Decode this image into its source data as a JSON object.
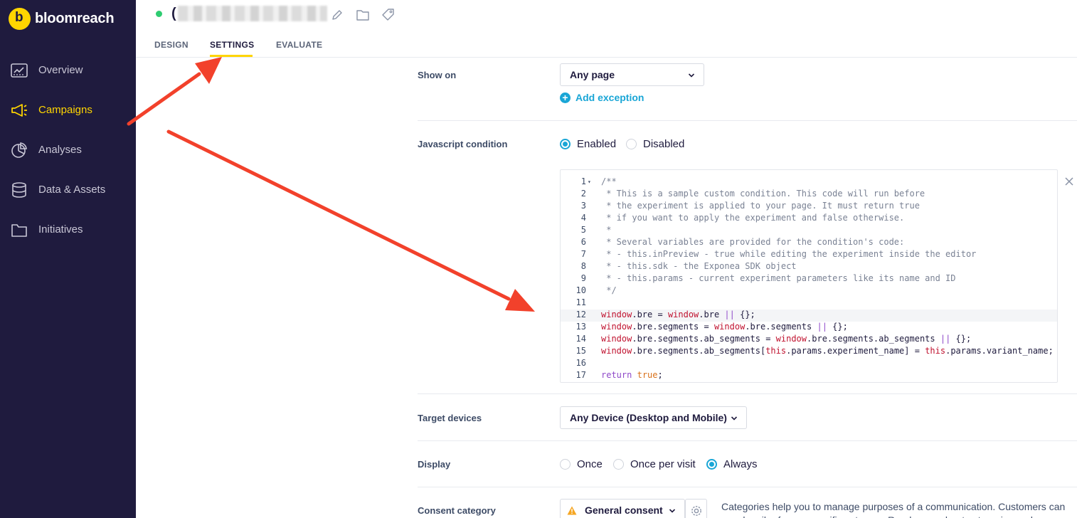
{
  "brand": {
    "name": "bloomreach",
    "mark": "b"
  },
  "sidebar": {
    "items": [
      {
        "label": "Overview",
        "icon": "overview-icon"
      },
      {
        "label": "Campaigns",
        "icon": "megaphone-icon",
        "active": true
      },
      {
        "label": "Analyses",
        "icon": "pie-chart-icon"
      },
      {
        "label": "Data & Assets",
        "icon": "database-icon"
      },
      {
        "label": "Initiatives",
        "icon": "folder-icon"
      }
    ]
  },
  "header": {
    "title_prefix": "(",
    "tabs": [
      "DESIGN",
      "SETTINGS",
      "EVALUATE"
    ],
    "active_tab": "SETTINGS"
  },
  "settings": {
    "show_on": {
      "label": "Show on",
      "value": "Any page",
      "add_exception": "Add exception"
    },
    "js_condition": {
      "label": "Javascript condition",
      "options": [
        "Enabled",
        "Disabled"
      ],
      "selected": "Enabled",
      "code": [
        "/**",
        " * This is a sample custom condition. This code will run before",
        " * the experiment is applied to your page. It must return true",
        " * if you want to apply the experiment and false otherwise.",
        " *",
        " * Several variables are provided for the condition's code:",
        " * - this.inPreview - true while editing the experiment inside the editor",
        " * - this.sdk - the Exponea SDK object",
        " * - this.params - current experiment parameters like its name and ID",
        " */",
        "",
        "window.bre = window.bre || {};",
        "window.bre.segments = window.bre.segments || {};",
        "window.bre.segments.ab_segments = window.bre.segments.ab_segments || {};",
        "window.bre.segments.ab_segments[this.params.experiment_name] = this.params.variant_name;",
        "",
        "return true;"
      ]
    },
    "target_devices": {
      "label": "Target devices",
      "value": "Any Device (Desktop and Mobile)"
    },
    "display": {
      "label": "Display",
      "options": [
        "Once",
        "Once per visit",
        "Always"
      ],
      "selected": "Always"
    },
    "consent": {
      "label": "Consent category",
      "value": "General consent",
      "help": "Categories help you to manage purposes of a communication. Customers can unsubscribe from a specific category. Read more about categories and"
    }
  },
  "colors": {
    "sidebar_bg": "#1f1b3e",
    "accent_yellow": "#ffd500",
    "link_blue": "#1aa6d6",
    "arrow_red": "#f2412b"
  }
}
